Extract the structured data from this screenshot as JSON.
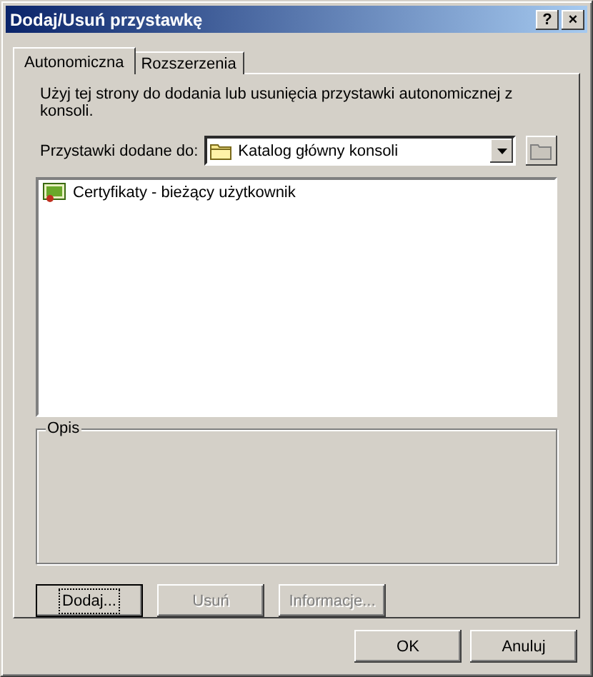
{
  "window": {
    "title": "Dodaj/Usuń przystawkę",
    "help": "?",
    "close": "×"
  },
  "tabs": [
    {
      "label": "Autonomiczna",
      "selected": true
    },
    {
      "label": "Rozszerzenia",
      "selected": false
    }
  ],
  "intro": "Użyj tej strony do dodania lub usunięcia przystawki autonomicznej z konsoli.",
  "target": {
    "label": "Przystawki dodane do:",
    "value": "Katalog główny konsoli"
  },
  "snapins": [
    {
      "name": "Certyfikaty - bieżący użytkownik",
      "selected": false
    }
  ],
  "description": {
    "title": "Opis"
  },
  "actions": [
    {
      "label": "Dodaj...",
      "disabled": false,
      "focused": true
    },
    {
      "label": "Usuń",
      "disabled": true,
      "focused": false
    },
    {
      "label": "Informacje...",
      "disabled": true,
      "focused": false
    }
  ],
  "buttons": [
    {
      "label": "OK"
    },
    {
      "label": "Anuluj"
    }
  ]
}
